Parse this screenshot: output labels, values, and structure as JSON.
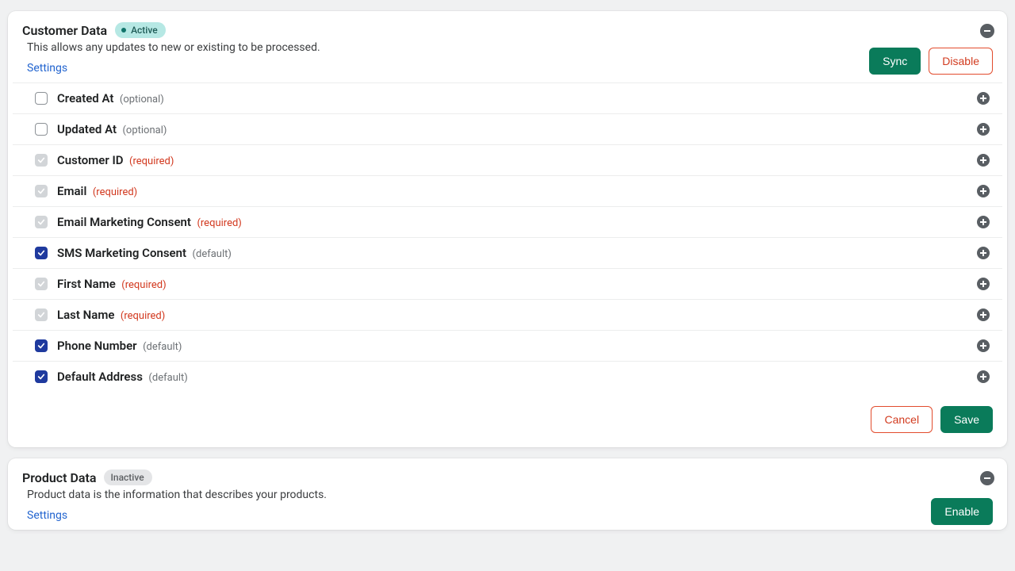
{
  "cards": {
    "customer": {
      "title": "Customer Data",
      "status": "Active",
      "desc": "This allows any updates to new or existing to be processed.",
      "settings": "Settings",
      "sync": "Sync",
      "disable": "Disable",
      "cancel": "Cancel",
      "save": "Save"
    },
    "product": {
      "title": "Product Data",
      "status": "Inactive",
      "desc": "Product data is the information that describes your products.",
      "settings": "Settings",
      "enable": "Enable"
    }
  },
  "tags": {
    "optional": "(optional)",
    "required": "(required)",
    "default": "(default)"
  },
  "fields": [
    {
      "name": "Created At",
      "tag": "optional",
      "state": "unchecked"
    },
    {
      "name": "Updated At",
      "tag": "optional",
      "state": "unchecked"
    },
    {
      "name": "Customer ID",
      "tag": "required",
      "state": "locked"
    },
    {
      "name": "Email",
      "tag": "required",
      "state": "locked"
    },
    {
      "name": "Email Marketing Consent",
      "tag": "required",
      "state": "locked"
    },
    {
      "name": "SMS Marketing Consent",
      "tag": "default",
      "state": "checked"
    },
    {
      "name": "First Name",
      "tag": "required",
      "state": "locked"
    },
    {
      "name": "Last Name",
      "tag": "required",
      "state": "locked"
    },
    {
      "name": "Phone Number",
      "tag": "default",
      "state": "checked"
    },
    {
      "name": "Default Address",
      "tag": "default",
      "state": "checked"
    }
  ]
}
